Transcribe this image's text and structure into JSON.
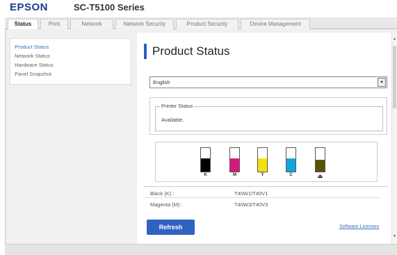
{
  "header": {
    "brand": "EPSON",
    "model": "SC-T5100 Series"
  },
  "tabs": [
    {
      "label": "Status",
      "active": true
    },
    {
      "label": "Print"
    },
    {
      "label": "Network"
    },
    {
      "label": "Network Security"
    },
    {
      "label": "Product Security"
    },
    {
      "label": "Device Management"
    }
  ],
  "sidebar": {
    "items": [
      {
        "label": "Product Status",
        "active": true
      },
      {
        "label": "Network Status"
      },
      {
        "label": "Hardware Status"
      },
      {
        "label": "Panel Snapshot"
      }
    ]
  },
  "main": {
    "title": "Product Status",
    "language": {
      "selected": "English"
    },
    "printer_status": {
      "legend": "Printer Status",
      "value": "Available."
    },
    "inks": [
      {
        "label": "K",
        "level": 0.55,
        "color": "#000000"
      },
      {
        "label": "M",
        "level": 0.55,
        "color": "#d6197e"
      },
      {
        "label": "Y",
        "level": 0.55,
        "color": "#f2e30c"
      },
      {
        "label": "C",
        "level": 0.55,
        "color": "#12a6d8"
      },
      {
        "label": "",
        "level": 0.5,
        "color": "#5a5206",
        "icon": "maintenance-box-icon"
      }
    ],
    "ink_table": [
      {
        "name": "Black (K) :",
        "value": "T40W1/T40V1"
      },
      {
        "name": "Magenta (M) :",
        "value": "T40W3/T40V3"
      }
    ],
    "refresh_label": "Refresh",
    "licenses_label": "Software Licenses"
  }
}
